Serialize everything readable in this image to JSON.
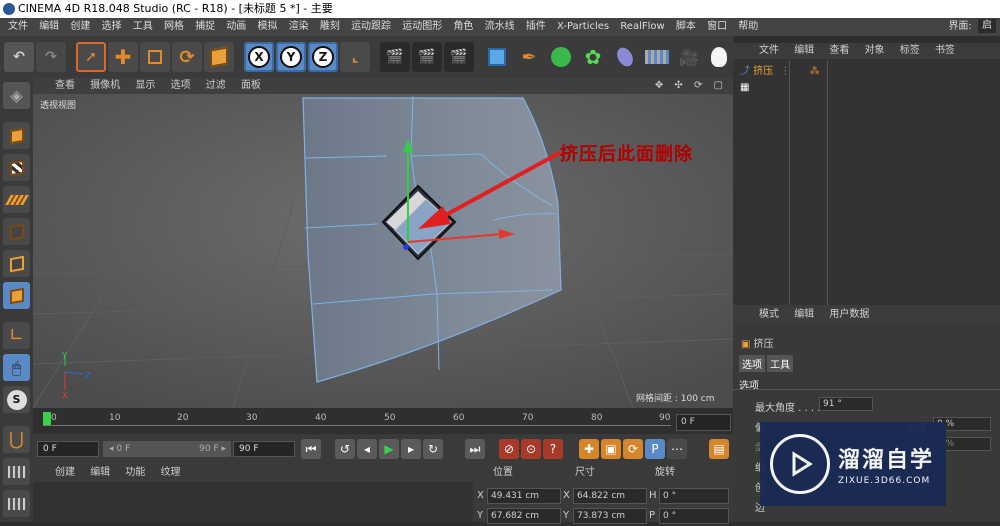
{
  "window": {
    "title": "CINEMA 4D R18.048 Studio (RC - R18) - [未标题 5 *] - 主要"
  },
  "menubar": {
    "items": [
      "文件",
      "编辑",
      "创建",
      "选择",
      "工具",
      "网格",
      "捕捉",
      "动画",
      "模拟",
      "渲染",
      "雕刻",
      "运动跟踪",
      "运动图形",
      "角色",
      "流水线",
      "插件",
      "X-Particles",
      "RealFlow",
      "脚本",
      "窗口",
      "帮助"
    ],
    "layout_label": "界面:",
    "layout_value": "启"
  },
  "toolbar": {
    "axis_x": "X",
    "axis_y": "Y",
    "axis_z": "Z"
  },
  "viewport": {
    "menu": [
      "查看",
      "摄像机",
      "显示",
      "选项",
      "过滤",
      "面板"
    ],
    "nav_icons": "✥ ✣ ⟳ ▢",
    "label": "透视视图",
    "grid_spacing": "网格间距 : 100 cm",
    "annotation": "挤压后此面删除",
    "axis_y": "Y",
    "axis_z": "Z",
    "axis_x": "X"
  },
  "timeline": {
    "ticks": [
      "0",
      "10",
      "20",
      "30",
      "40",
      "50",
      "60",
      "70",
      "80",
      "90"
    ],
    "end_frame": "0 F"
  },
  "playback": {
    "current": "0 F",
    "range_start": "◂ 0 F",
    "range_end": "90 F ▸",
    "max": "90 F"
  },
  "bottom_panel": {
    "tabs": [
      "创建",
      "编辑",
      "功能",
      "纹理"
    ]
  },
  "coordinates": {
    "headers": {
      "position": "位置",
      "size": "尺寸",
      "rotation": "旋转"
    },
    "rows": [
      {
        "axis": "X",
        "pos": "49.431 cm",
        "saxis": "X",
        "size": "64.822 cm",
        "raxis": "H",
        "rot": "0 °"
      },
      {
        "axis": "Y",
        "pos": "67.682 cm",
        "saxis": "Y",
        "size": "73.873 cm",
        "raxis": "P",
        "rot": "0 °"
      }
    ]
  },
  "object_manager": {
    "menu": [
      "文件",
      "编辑",
      "查看",
      "对象",
      "标签",
      "书签"
    ],
    "object_name": "挤压"
  },
  "attributes": {
    "menu": [
      "模式",
      "编辑",
      "用户数据"
    ],
    "object_name": "挤压",
    "tabs": [
      "选项",
      "工具"
    ],
    "section": "选项",
    "max_angle_label": "最大角度 . . . .",
    "max_angle_value": "91 °",
    "offset_label": "偏",
    "row3_label": "剑",
    "row4_label": "细",
    "row5_label": "创",
    "row6_label": "边",
    "pct1": "0 %",
    "pct2": "0 %",
    "extra": "直度"
  },
  "watermark": {
    "title": "溜溜自学",
    "url": "ZIXUE.3D66.COM"
  },
  "colors": {
    "accent": "#5a8ac6",
    "annotation": "#b20000",
    "model": "#7a8696",
    "edges": "#7fb2e8"
  }
}
